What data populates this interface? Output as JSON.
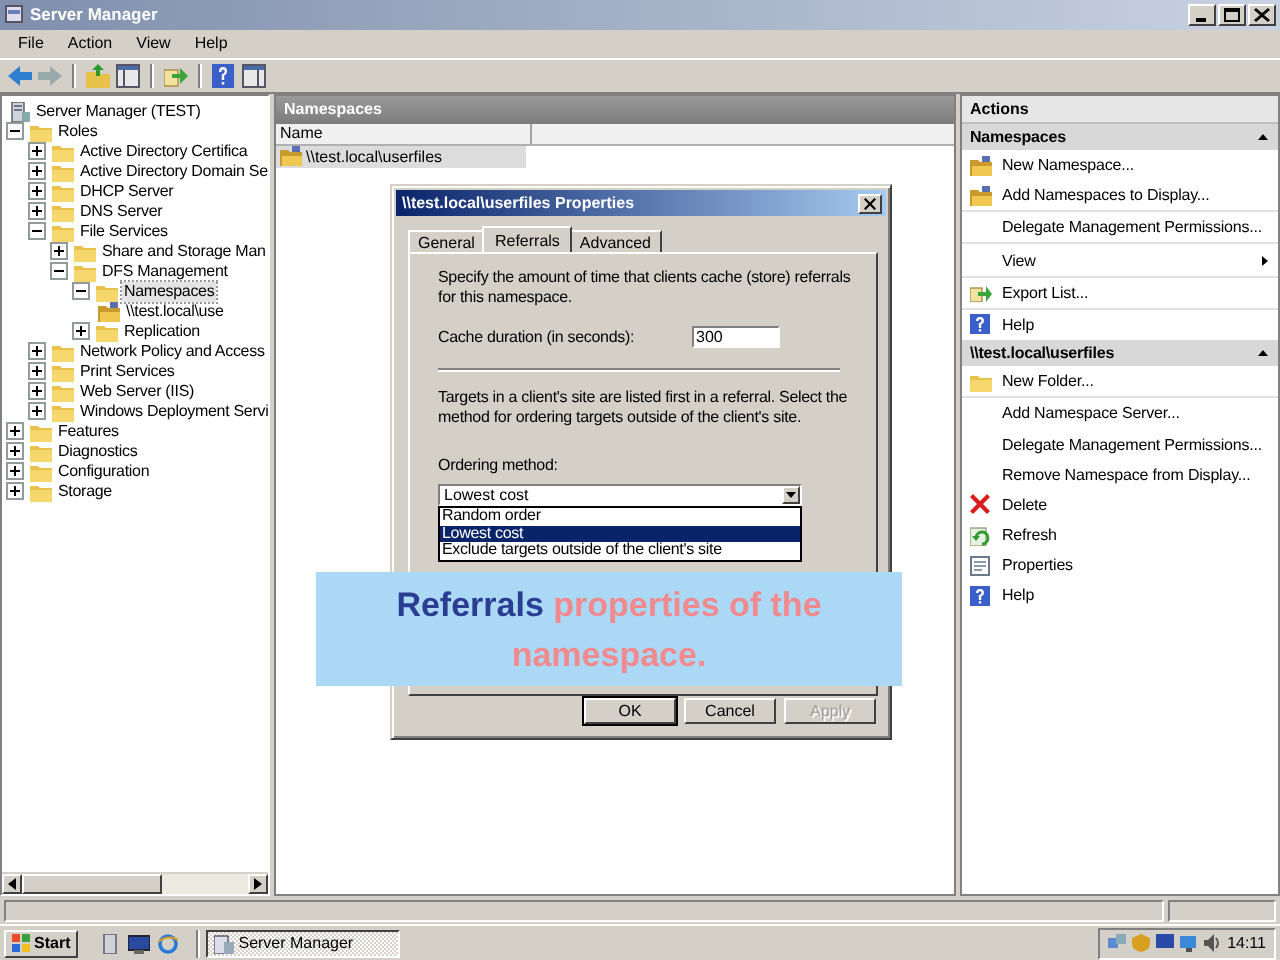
{
  "window": {
    "title": "Server Manager"
  },
  "menu": [
    "File",
    "Action",
    "View",
    "Help"
  ],
  "tree": [
    {
      "label": "Server Manager (TEST)",
      "kind": "root",
      "selected": false,
      "children": [
        {
          "label": "Roles",
          "kind": "node",
          "expanded": true,
          "selected": false,
          "children": [
            {
              "label": "Active Directory Certifica",
              "kind": "node",
              "expanded": false,
              "selected": false
            },
            {
              "label": "Active Directory Domain Se",
              "kind": "node",
              "expanded": false,
              "selected": false
            },
            {
              "label": "DHCP Server",
              "kind": "node",
              "expanded": false,
              "selected": false
            },
            {
              "label": "DNS Server",
              "kind": "node",
              "expanded": false,
              "selected": false
            },
            {
              "label": "File Services",
              "kind": "node",
              "expanded": true,
              "selected": false,
              "children": [
                {
                  "label": "Share and Storage Man",
                  "kind": "node",
                  "expanded": false,
                  "selected": false
                },
                {
                  "label": "DFS Management",
                  "kind": "node",
                  "expanded": true,
                  "selected": false,
                  "children": [
                    {
                      "label": "Namespaces",
                      "kind": "node",
                      "expanded": true,
                      "selected": true,
                      "children": [
                        {
                          "label": "\\\\test.local\\use",
                          "kind": "leaf",
                          "selected": false
                        }
                      ]
                    },
                    {
                      "label": "Replication",
                      "kind": "node",
                      "expanded": false,
                      "selected": false
                    }
                  ]
                }
              ]
            },
            {
              "label": "Network Policy and Access",
              "kind": "node",
              "expanded": false,
              "selected": false
            },
            {
              "label": "Print Services",
              "kind": "node",
              "expanded": false,
              "selected": false
            },
            {
              "label": "Web Server (IIS)",
              "kind": "node",
              "expanded": false,
              "selected": false
            },
            {
              "label": "Windows Deployment Servi",
              "kind": "node",
              "expanded": false,
              "selected": false
            }
          ]
        },
        {
          "label": "Features",
          "kind": "node",
          "expanded": false,
          "selected": false
        },
        {
          "label": "Diagnostics",
          "kind": "node",
          "expanded": false,
          "selected": false
        },
        {
          "label": "Configuration",
          "kind": "node",
          "expanded": false,
          "selected": false
        },
        {
          "label": "Storage",
          "kind": "node",
          "expanded": false,
          "selected": false
        }
      ]
    }
  ],
  "content": {
    "title": "Namespaces",
    "columns": [
      "Name"
    ],
    "rows": [
      {
        "name": "\\\\test.local\\userfiles",
        "selected": true
      }
    ]
  },
  "actions": {
    "title": "Actions",
    "sections": [
      {
        "title": "Namespaces",
        "items": [
          {
            "label": "New Namespace...",
            "kind": "namespace"
          },
          {
            "label": "Add Namespaces to Display...",
            "kind": "namespace"
          },
          {
            "label": "Delegate Management Permissions...",
            "kind": "plain"
          },
          {
            "label": "View",
            "kind": "submenu"
          },
          {
            "label": "Export List...",
            "kind": "export"
          },
          {
            "label": "Help",
            "kind": "help"
          }
        ]
      },
      {
        "title": "\\\\test.local\\userfiles",
        "items": [
          {
            "label": "New Folder...",
            "kind": "folder"
          },
          {
            "label": "Add Namespace Server...",
            "kind": "plain"
          },
          {
            "label": "Delegate Management Permissions...",
            "kind": "plain"
          },
          {
            "label": "Remove Namespace from Display...",
            "kind": "plain"
          },
          {
            "label": "Delete",
            "kind": "delete"
          },
          {
            "label": "Refresh",
            "kind": "refresh"
          },
          {
            "label": "Properties",
            "kind": "properties"
          },
          {
            "label": "Help",
            "kind": "help"
          }
        ]
      }
    ]
  },
  "dialog": {
    "title": "\\\\test.local\\userfiles Properties",
    "tabs": [
      {
        "label": "General",
        "selected": false
      },
      {
        "label": "Referrals",
        "selected": true
      },
      {
        "label": "Advanced",
        "selected": false
      }
    ],
    "intro": "Specify the amount of time that clients cache (store) referrals for this namespace.",
    "cache_label": "Cache duration (in seconds):",
    "cache_value": "300",
    "targets_text": "Targets in a client's site are listed first in a referral. Select the method for ordering targets outside of the client's site.",
    "ordering_label": "Ordering method:",
    "ordering_value": "Lowest cost",
    "ordering_options": [
      {
        "label": "Random order",
        "selected": false
      },
      {
        "label": "Lowest cost",
        "selected": true
      },
      {
        "label": "Exclude targets outside of the client's site",
        "selected": false
      }
    ],
    "buttons": [
      {
        "label": "OK",
        "disabled": false
      },
      {
        "label": "Cancel",
        "disabled": false
      },
      {
        "label": "Apply",
        "disabled": true
      }
    ]
  },
  "caption": {
    "text": "**Referrals** properties of the namespace."
  },
  "taskbar": {
    "start": "Start",
    "tasks": [
      {
        "label": "Server Manager",
        "selected": true
      }
    ],
    "clock": "14:11"
  }
}
